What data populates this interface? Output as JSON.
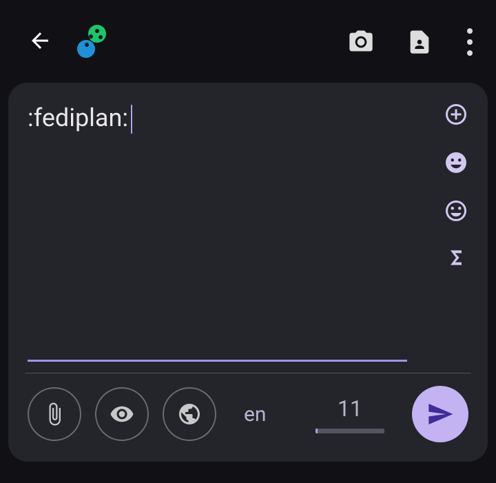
{
  "compose": {
    "text": ":fediplan:",
    "bottom": {
      "language": "en",
      "counter": "11"
    }
  }
}
